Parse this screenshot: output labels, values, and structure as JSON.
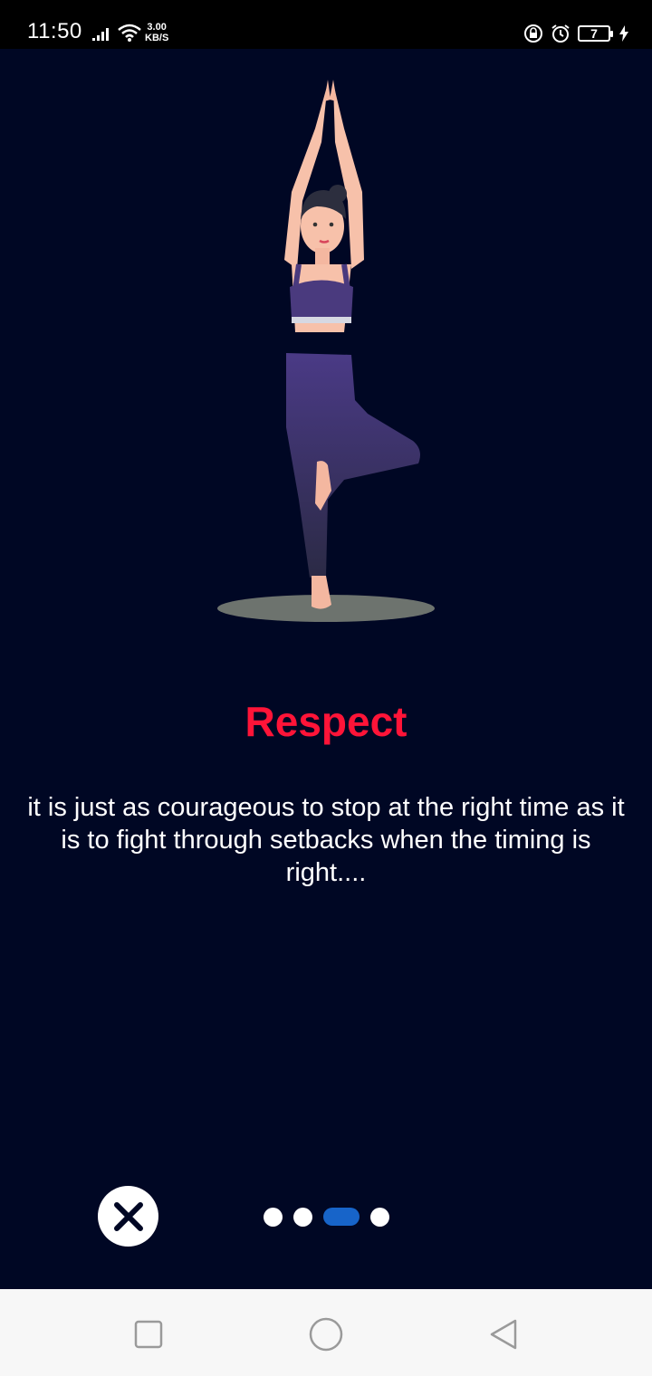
{
  "status_bar": {
    "time": "11:50",
    "speed_value": "3.00",
    "speed_unit": "KB/S",
    "battery_level": "7",
    "icons": [
      "signal-icon",
      "wifi-icon",
      "lock-rotation-icon",
      "alarm-icon",
      "battery-icon",
      "charging-icon"
    ]
  },
  "onboarding": {
    "title": "Respect",
    "description": "it is just as courageous to stop at the right time as it is to fight through setbacks when the timing is right....",
    "page_count": 4,
    "current_page": 3,
    "illustration": "woman-tree-pose-yoga"
  },
  "colors": {
    "background": "#000724",
    "title": "#ff1438",
    "active_dot": "#1764c9",
    "inactive_dot": "#ffffff"
  },
  "nav_bar": {
    "buttons": [
      "recent-apps-icon",
      "home-icon",
      "back-icon"
    ]
  }
}
